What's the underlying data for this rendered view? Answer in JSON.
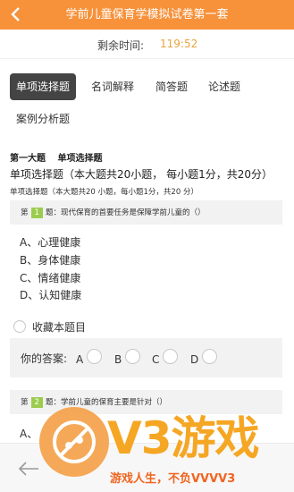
{
  "header": {
    "title": "学前儿童保育学模拟试卷第一套"
  },
  "timer": {
    "label": "剩余时间:",
    "value": "119:52"
  },
  "tabs": [
    {
      "label": "单项选择题",
      "active": true
    },
    {
      "label": "名词解释",
      "active": false
    },
    {
      "label": "简答题",
      "active": false
    },
    {
      "label": "论述题",
      "active": false
    },
    {
      "label": "案例分析题",
      "active": false
    }
  ],
  "section": {
    "title": "第一大题　 单项选择题",
    "desc_big": "单项选择题（本大题共20小题， 每小题1分，共20分）",
    "desc_small": "单项选择题（本大题共20 小题，每小题1分，共20 分）"
  },
  "questions": [
    {
      "prefix": "第",
      "number": "1",
      "text": "题：现代保育的首要任务是保障学前儿童的（）",
      "options": [
        "A、心理健康",
        "B、身体健康",
        "C、情绪健康",
        "D、认知健康"
      ]
    },
    {
      "prefix": "第",
      "number": "2",
      "text": "题：学前儿童的保育主要是针对（）",
      "options": [
        "A、"
      ]
    }
  ],
  "favorite": {
    "label": "收藏本题目"
  },
  "answer": {
    "label": "你的答案:",
    "choices": [
      "A",
      "B",
      "C",
      "D"
    ]
  },
  "watermark": {
    "logo_text": "V3游戏",
    "slogan": "游戏人生，不负VVVV3"
  },
  "colors": {
    "header": "#f7913a",
    "timer": "#e8a43f",
    "active_tab": "#444444",
    "qnum_badge": "#9ccc4e"
  }
}
